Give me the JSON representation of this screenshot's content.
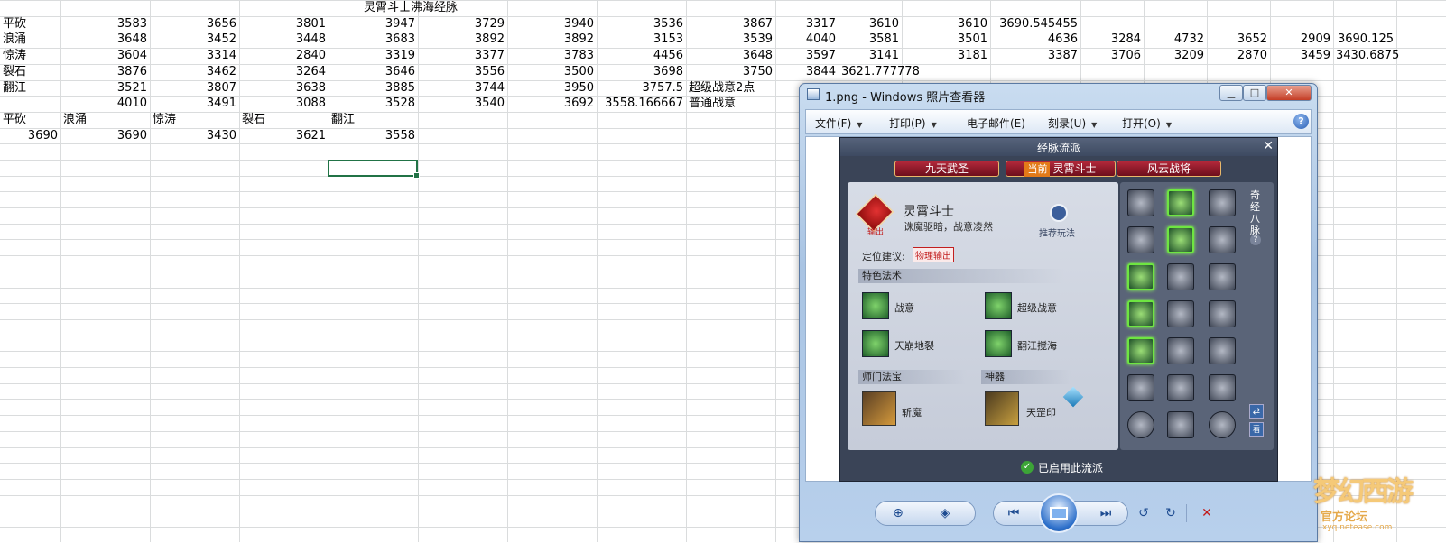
{
  "spreadsheet": {
    "header_title": "灵霄斗士沸海经脉",
    "rows": [
      {
        "label": "平砍",
        "values": [
          "3583",
          "3656",
          "3801",
          "3947",
          "3729",
          "3940",
          "3536",
          "3867",
          "3317",
          "3610",
          "3610",
          "3690.545455"
        ]
      },
      {
        "label": "浪涌",
        "values": [
          "3648",
          "3452",
          "3448",
          "3683",
          "3892",
          "3892",
          "3153",
          "3539",
          "4040",
          "3581",
          "3501",
          "4636",
          "3284",
          "4732",
          "3652",
          "2909",
          "3690.125"
        ]
      },
      {
        "label": "惊涛",
        "values": [
          "3604",
          "3314",
          "2840",
          "3319",
          "3377",
          "3783",
          "4456",
          "3648",
          "3597",
          "3141",
          "3181",
          "3387",
          "3706",
          "3209",
          "2870",
          "3459",
          "3430.6875"
        ]
      },
      {
        "label": "裂石",
        "values": [
          "3876",
          "3462",
          "3264",
          "3646",
          "3556",
          "3500",
          "3698",
          "3750",
          "3844",
          "3621.777778"
        ]
      },
      {
        "label": "翻江",
        "values": [
          "3521",
          "3807",
          "3638",
          "3885",
          "3744",
          "3950",
          "3757.5"
        ],
        "note": "超级战意2点"
      },
      {
        "label": "",
        "values": [
          "4010",
          "3491",
          "3088",
          "3528",
          "3540",
          "3692",
          "3558.166667"
        ],
        "note": "普通战意"
      }
    ],
    "summary_labels": [
      "平砍",
      "浪涌",
      "惊涛",
      "裂石",
      "翻江"
    ],
    "summary_values": [
      "3690",
      "3690",
      "3430",
      "3621",
      "3558"
    ]
  },
  "viewer": {
    "title": "1.png - Windows 照片查看器",
    "window_buttons": {
      "minimize": "▁",
      "maximize": "□",
      "close": "✕"
    },
    "menu": [
      "文件(F)",
      "打印(P)",
      "电子邮件(E)",
      "刻录(U)",
      "打开(O)"
    ],
    "menu_has_arrow": [
      true,
      true,
      false,
      true,
      true
    ],
    "help": "?",
    "toolbar": {
      "zoom": "⊕",
      "fit": "◈",
      "prev": "⏮",
      "next": "⏭",
      "rotate_ccw": "↺",
      "rotate_cw": "↻",
      "delete": "✕"
    }
  },
  "game": {
    "title": "经脉流派",
    "close": "✕",
    "tabs": [
      "九天武圣",
      "灵霄斗士",
      "风云战将"
    ],
    "current_tag": "当前",
    "class_name": "灵霄斗士",
    "class_tag": "输出",
    "motto": "诛魔驱暗，战意凌然",
    "recommend_label": "推荐玩法",
    "position_label": "定位建议:",
    "position_value": "物理输出",
    "section_special": "特色法术",
    "skills": [
      "战意",
      "超级战意",
      "天崩地裂",
      "翻江搅海"
    ],
    "section_treasure": "师门法宝",
    "section_artifact": "神器",
    "treasure_name": "斩魔",
    "artifact_name": "天罡印",
    "side_label": "奇经八脉",
    "side_help": "?",
    "swap": "⇄",
    "view": "看",
    "enabled_label": "已启用此流派",
    "enabled_check": "✓"
  },
  "watermark": {
    "logo": "梦幻西游",
    "sub": "官方论坛",
    "url": "xyq.netease.com"
  },
  "colors": {
    "selection": "#217346",
    "grid": "#dadcdd",
    "node_active": "#6ee641"
  }
}
